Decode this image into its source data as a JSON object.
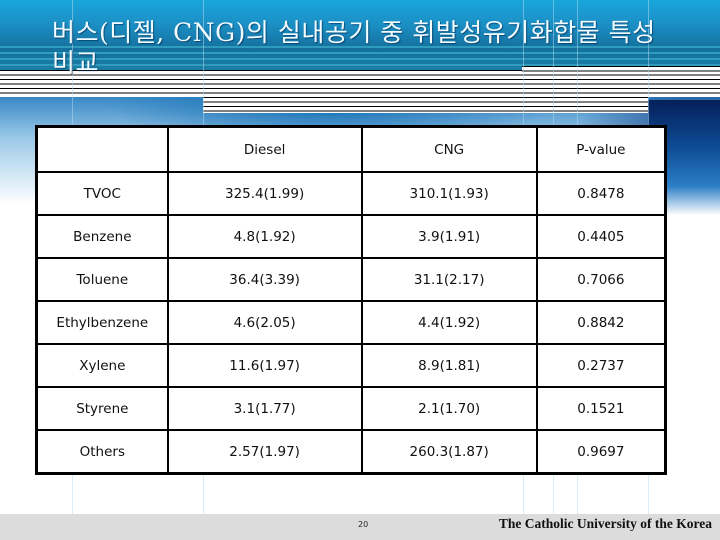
{
  "slide": {
    "title": "버스(디젤, CNG)의  실내공기 중 휘발성유기화합물 특성 비교",
    "page_number": "20",
    "organization": "The Catholic University of the Korea"
  },
  "table": {
    "headers": [
      "",
      "Diesel",
      "CNG",
      "P-value"
    ],
    "rows": [
      {
        "compound": "TVOC",
        "diesel": "325.4(1.99)",
        "cng": "310.1(1.93)",
        "p_value": "0.8478"
      },
      {
        "compound": "Benzene",
        "diesel": "4.8(1.92)",
        "cng": "3.9(1.91)",
        "p_value": "0.4405"
      },
      {
        "compound": "Toluene",
        "diesel": "36.4(3.39)",
        "cng": "31.1(2.17)",
        "p_value": "0.7066"
      },
      {
        "compound": "Ethylbenzene",
        "diesel": "4.6(2.05)",
        "cng": "4.4(1.92)",
        "p_value": "0.8842"
      },
      {
        "compound": "Xylene",
        "diesel": "11.6(1.97)",
        "cng": "8.9(1.81)",
        "p_value": "0.2737"
      },
      {
        "compound": "Styrene",
        "diesel": "3.1(1.77)",
        "cng": "2.1(1.70)",
        "p_value": "0.1521"
      },
      {
        "compound": "Others",
        "diesel": "2.57(1.97)",
        "cng": "260.3(1.87)",
        "p_value": "0.9697"
      }
    ]
  },
  "theme": {
    "header_blue": "#1b8fc4",
    "footer_gray": "#dcdcdc"
  }
}
